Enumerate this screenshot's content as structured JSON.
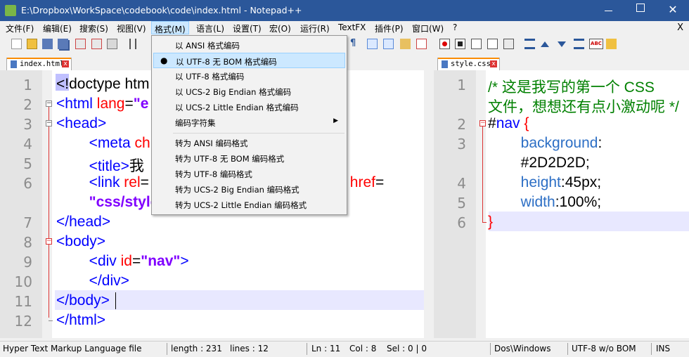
{
  "window": {
    "title": "E:\\Dropbox\\WorkSpace\\codebook\\code\\index.html - Notepad++",
    "close_glyph": "✕"
  },
  "menubar": {
    "items": [
      "文件(F)",
      "编辑(E)",
      "搜索(S)",
      "视图(V)",
      "格式(M)",
      "语言(L)",
      "设置(T)",
      "宏(O)",
      "运行(R)",
      "TextFX",
      "插件(P)",
      "窗口(W)",
      "?"
    ],
    "active": "格式(M)",
    "close": "X"
  },
  "format_menu": {
    "items": [
      {
        "label": "以 ANSI 格式编码"
      },
      {
        "label": "以 UTF-8 无 BOM 格式编码",
        "checked": true,
        "highlighted": true
      },
      {
        "label": "以 UTF-8 格式编码"
      },
      {
        "label": "以 UCS-2 Big Endian 格式编码"
      },
      {
        "label": "以 UCS-2 Little Endian 格式编码"
      },
      {
        "label": "编码字符集",
        "submenu": true
      }
    ],
    "convert_items": [
      {
        "label": "转为 ANSI 编码格式"
      },
      {
        "label": "转为 UTF-8 无 BOM 编码格式"
      },
      {
        "label": "转为 UTF-8 编码格式"
      },
      {
        "label": "转为 UCS-2 Big Endian 编码格式"
      },
      {
        "label": "转为 UCS-2 Little Endian 编码格式"
      }
    ],
    "bullet": "●",
    "submenu_arrow": "▶"
  },
  "tabs": {
    "left": {
      "label": "index.html",
      "close": "x"
    },
    "right": {
      "label": "style.css",
      "close": "x"
    }
  },
  "left_editor": {
    "lines": [
      {
        "num": "1",
        "segments": [
          {
            "t": "<!doctype htm",
            "c": "txt"
          }
        ]
      },
      {
        "num": "2",
        "segments": [
          {
            "t": "<html ",
            "c": "tag"
          },
          {
            "t": "lang",
            "c": "attr"
          },
          {
            "t": "=",
            "c": "txt"
          },
          {
            "t": "\"e",
            "c": "val"
          }
        ]
      },
      {
        "num": "3",
        "segments": [
          {
            "t": "<head>",
            "c": "tag"
          }
        ]
      },
      {
        "num": "4",
        "segments": [
          {
            "t": "        <meta ",
            "c": "tag"
          },
          {
            "t": "ch",
            "c": "attr"
          }
        ]
      },
      {
        "num": "5",
        "segments": [
          {
            "t": "        <title>",
            "c": "tag"
          },
          {
            "t": "我",
            "c": "txt"
          }
        ]
      },
      {
        "num": "6",
        "segments": [
          {
            "t": "        <link ",
            "c": "tag"
          },
          {
            "t": "rel",
            "c": "attr"
          },
          {
            "t": "=",
            "c": "txt"
          }
        ]
      },
      {
        "num": "",
        "segments": [
          {
            "t": "        \"css/style",
            "c": "val"
          }
        ]
      },
      {
        "num": "7",
        "segments": [
          {
            "t": "</head>",
            "c": "tag"
          }
        ]
      },
      {
        "num": "8",
        "segments": [
          {
            "t": "<body>",
            "c": "tag"
          }
        ]
      },
      {
        "num": "9",
        "segments": [
          {
            "t": "        <div ",
            "c": "tag"
          },
          {
            "t": "id",
            "c": "attr"
          },
          {
            "t": "=",
            "c": "txt"
          },
          {
            "t": "\"nav\"",
            "c": "val"
          },
          {
            "t": ">",
            "c": "tag"
          }
        ]
      },
      {
        "num": "10",
        "segments": [
          {
            "t": "        </div>",
            "c": "tag"
          }
        ]
      },
      {
        "num": "11",
        "segments": [
          {
            "t": "</body>",
            "c": "tag"
          }
        ]
      },
      {
        "num": "12",
        "segments": [
          {
            "t": "</html>",
            "c": "tag"
          }
        ]
      }
    ],
    "line6_tail": [
      {
        "t": "\" ",
        "c": "val"
      },
      {
        "t": "href",
        "c": "attr"
      },
      {
        "t": "=",
        "c": "txt"
      }
    ]
  },
  "right_editor": {
    "lines": [
      {
        "num": "1",
        "segments": [
          {
            "t": "/* 这是我写的第一个 CSS",
            "c": "cmt"
          }
        ]
      },
      {
        "num": "",
        "segments": [
          {
            "t": "文件，想想还有点小激动呢 */",
            "c": "cmt"
          }
        ]
      },
      {
        "num": "2",
        "segments": [
          {
            "t": "#",
            "c": "txt"
          },
          {
            "t": "nav",
            "c": "sel"
          },
          {
            "t": " {",
            "c": "attr"
          }
        ]
      },
      {
        "num": "3",
        "segments": [
          {
            "t": "        background",
            "c": "prop"
          },
          {
            "t": ":",
            "c": "txt"
          }
        ]
      },
      {
        "num": "",
        "segments": [
          {
            "t": "        #2D2D2D;",
            "c": "txt"
          }
        ]
      },
      {
        "num": "4",
        "segments": [
          {
            "t": "        height",
            "c": "prop"
          },
          {
            "t": ":45px;",
            "c": "txt"
          }
        ]
      },
      {
        "num": "5",
        "segments": [
          {
            "t": "        width",
            "c": "prop"
          },
          {
            "t": ":100%;",
            "c": "txt"
          }
        ]
      },
      {
        "num": "6",
        "segments": [
          {
            "t": "}",
            "c": "attr"
          }
        ]
      }
    ]
  },
  "status": {
    "file_type": "Hyper Text Markup Language file",
    "length": "length : 231",
    "lines": "lines : 12",
    "ln": "Ln : 11",
    "col": "Col : 8",
    "sel": "Sel : 0 | 0",
    "eol": "Dos\\Windows",
    "encoding": "UTF-8 w/o BOM",
    "mode": "INS"
  },
  "colors": {
    "titlebar": "#2b579a",
    "highlight_line": "#e8e8ff",
    "menu_highlight": "#cce8ff"
  }
}
